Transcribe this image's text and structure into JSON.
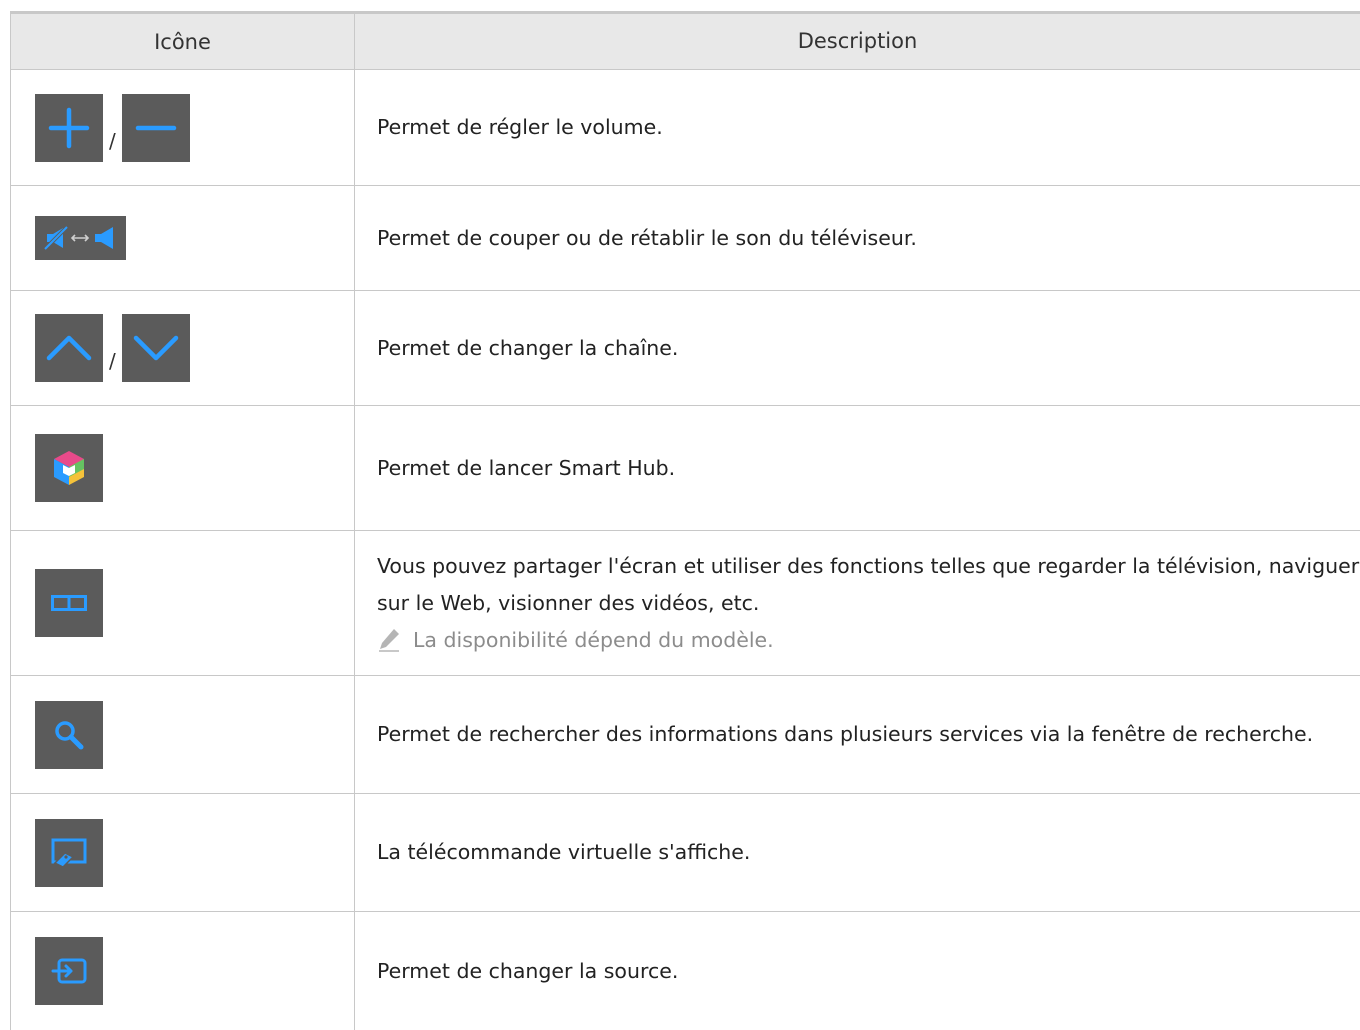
{
  "header": {
    "icon_col": "Icône",
    "desc_col": "Description"
  },
  "rows": [
    {
      "icons": [
        "plus-icon",
        "minus-icon"
      ],
      "separator": "/",
      "description": "Permet de régler le volume."
    },
    {
      "icons": [
        "mute-toggle-icon"
      ],
      "description": "Permet de couper ou de rétablir le son du téléviseur."
    },
    {
      "icons": [
        "chevron-up-icon",
        "chevron-down-icon"
      ],
      "separator": "/",
      "description": "Permet de changer la chaîne."
    },
    {
      "icons": [
        "smart-hub-icon"
      ],
      "description": "Permet de lancer Smart Hub."
    },
    {
      "icons": [
        "split-screen-icon"
      ],
      "description": "Vous pouvez partager l'écran et utiliser des fonctions telles que regarder la télévision, naviguer sur le Web, visionner des vidéos, etc.",
      "note": "La disponibilité dépend du modèle."
    },
    {
      "icons": [
        "search-icon"
      ],
      "description": "Permet de rechercher des informations dans plusieurs services via la fenêtre de recherche."
    },
    {
      "icons": [
        "virtual-remote-icon"
      ],
      "description": "La télécommande virtuelle s'affiche."
    },
    {
      "icons": [
        "source-icon"
      ],
      "description": "Permet de changer la source."
    }
  ],
  "colors": {
    "icon_bg": "#5b5b5b",
    "icon_blue": "#2a9bff",
    "header_bg": "#e8e8e8",
    "border": "#c8c8c8",
    "note_text": "#8c8c8c"
  }
}
